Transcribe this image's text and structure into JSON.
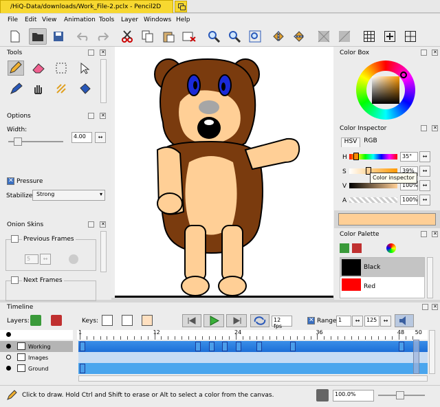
{
  "window": {
    "title": "/HiQ-Data/downloads/Work_File-2.pclx - Pencil2D"
  },
  "menu": [
    "File",
    "Edit",
    "View",
    "Animation",
    "Tools",
    "Layer",
    "Windows",
    "Help"
  ],
  "tools_panel": {
    "title": "Tools"
  },
  "options_panel": {
    "title": "Options",
    "width_label": "Width:",
    "width_value": "4.00",
    "pressure_label": "Pressure",
    "stabilizer_label": "Stabilizer",
    "stabilizer_value": "Strong"
  },
  "onion_panel": {
    "title": "Onion Skins",
    "previous": "Previous Frames",
    "next": "Next Frames",
    "prev_value": "5"
  },
  "color_box": {
    "title": "Color Box"
  },
  "color_inspector": {
    "title": "Color Inspector",
    "tab_hsv": "HSV",
    "tab_rgb": "RGB",
    "h_label": "H",
    "s_label": "S",
    "v_label": "V",
    "a_label": "A",
    "h_value": "35°",
    "s_value": "39%",
    "v_value": "100%",
    "a_value": "100%",
    "tooltip": "Color inspector"
  },
  "current_color": "#ffcf96",
  "color_palette": {
    "title": "Color Palette",
    "items": [
      {
        "name": "Black",
        "color": "#000000"
      },
      {
        "name": "Red",
        "color": "#ff0000"
      }
    ]
  },
  "timeline": {
    "title": "Timeline",
    "layers_label": "Layers:",
    "keys_label": "Keys:",
    "fps": "12 fps",
    "range_label": "Range",
    "range_start": "1",
    "range_end": "125",
    "ruler": [
      "1",
      "12",
      "24",
      "36",
      "48",
      "50"
    ],
    "layers": [
      {
        "name": "Working"
      },
      {
        "name": "Images"
      },
      {
        "name": "Ground"
      }
    ]
  },
  "status": {
    "hint": "Click to draw. Hold Ctrl and Shift to erase or Alt to select a color from the canvas.",
    "zoom": "100.0%"
  }
}
